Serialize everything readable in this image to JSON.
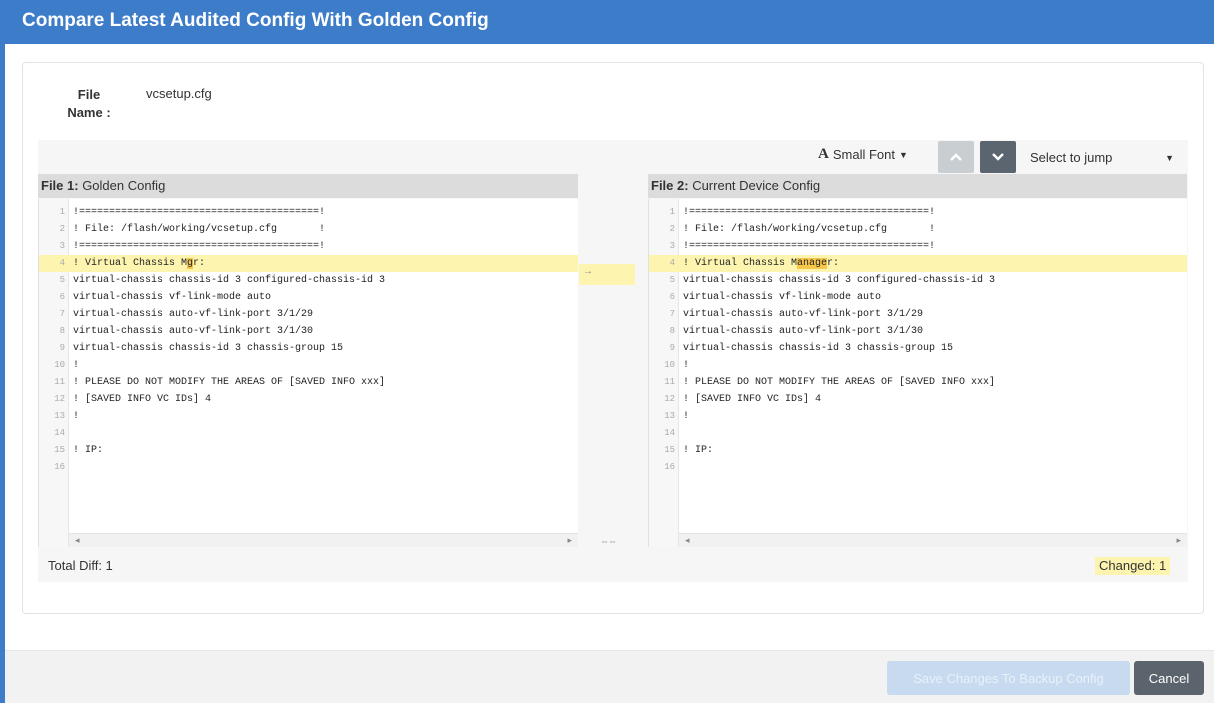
{
  "dialog": {
    "title": "Compare Latest Audited Config With Golden Config"
  },
  "file": {
    "label": "File Name :",
    "value": "vcsetup.cfg"
  },
  "toolbar": {
    "font_label": "Small Font",
    "font_glyph": "A",
    "up_icon": "chevron-up-icon",
    "down_icon": "chevron-down-icon",
    "jump_placeholder": "Select to jump"
  },
  "left_pane": {
    "title_bold": "File 1:",
    "title_rest": " Golden Config",
    "lines": [
      "!========================================!",
      "! File: /flash/working/vcsetup.cfg       !",
      "!========================================!",
      "! Virtual Chassis Mgr:",
      "virtual-chassis chassis-id 3 configured-chassis-id 3",
      "virtual-chassis vf-link-mode auto",
      "virtual-chassis auto-vf-link-port 3/1/29",
      "virtual-chassis auto-vf-link-port 3/1/30",
      "virtual-chassis chassis-id 3 chassis-group 15",
      "!",
      "! PLEASE DO NOT MODIFY THE AREAS OF [SAVED INFO xxx]",
      "! [SAVED INFO VC IDs] 4",
      "!",
      "",
      "! IP:",
      ""
    ],
    "changed_line": {
      "before": "! Virtual Chassis M",
      "highlight": "g",
      "after": "r:"
    }
  },
  "right_pane": {
    "title_bold": "File 2:",
    "title_rest": " Current Device Config",
    "lines": [
      "!========================================!",
      "! File: /flash/working/vcsetup.cfg       !",
      "!========================================!",
      "! Virtual Chassis Manager:",
      "virtual-chassis chassis-id 3 configured-chassis-id 3",
      "virtual-chassis vf-link-mode auto",
      "virtual-chassis auto-vf-link-port 3/1/29",
      "virtual-chassis auto-vf-link-port 3/1/30",
      "virtual-chassis chassis-id 3 chassis-group 15",
      "!",
      "! PLEASE DO NOT MODIFY THE AREAS OF [SAVED INFO xxx]",
      "! [SAVED INFO VC IDs] 4",
      "!",
      "",
      "! IP:",
      ""
    ],
    "changed_line": {
      "before": "! Virtual Chassis M",
      "highlight": "anage",
      "after": "r:"
    }
  },
  "diff": {
    "total_label": "Total Diff: 1",
    "changed_label": "Changed: 1",
    "changed_index": 3,
    "colors": {
      "changed_bg": "#fdf4b0",
      "changed_hl": "#f8c74a"
    }
  },
  "footer": {
    "save_label": "Save Changes To Backup Config",
    "cancel_label": "Cancel"
  },
  "colors": {
    "header": "#3d7cc9",
    "cancel_button": "#5b646d",
    "save_button_disabled": "#c7daf0"
  }
}
